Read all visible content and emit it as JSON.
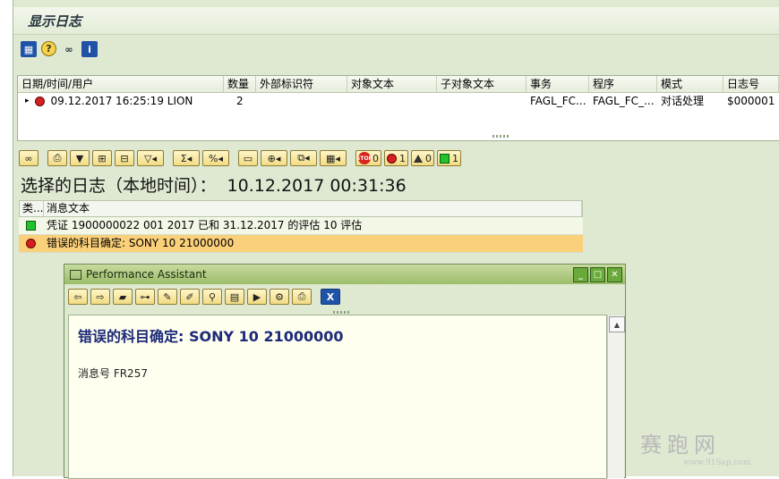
{
  "window": {
    "title": "显示日志"
  },
  "toolbar_top": {
    "buttons": [
      {
        "icon": "grid-icon"
      },
      {
        "icon": "help-icon",
        "glyph": "?"
      },
      {
        "icon": "glasses-icon",
        "glyph": "👓"
      },
      {
        "icon": "info-icon",
        "glyph": "i"
      }
    ]
  },
  "log_table": {
    "columns": [
      "日期/时间/用户",
      "数量",
      "外部标识符",
      "对象文本",
      "子对象文本",
      "事务",
      "程序",
      "模式",
      "日志号"
    ],
    "rows": [
      {
        "expander": "▸",
        "datetime_user": "09.12.2017  16:25:19  LION",
        "count": "2",
        "external_id": "",
        "object_text": "",
        "subobject_text": "",
        "transaction": "FAGL_FC...",
        "program": "FAGL_FC_...",
        "mode": "对话处理",
        "log_no": "$000001"
      }
    ]
  },
  "toolbar2": {
    "stop_count": "0",
    "error_count": "1",
    "warning_count": "0",
    "success_count": "1"
  },
  "selected_log": {
    "label": "选择的日志（本地时间）：",
    "timestamp": "10.12.2017 00:31:36"
  },
  "message_table": {
    "columns": [
      "类...",
      "消息文本"
    ],
    "rows": [
      {
        "status": "success",
        "text": "凭证 1900000022 001 2017 已和 31.12.2017 的评估 10 评估"
      },
      {
        "status": "error",
        "text": "错误的科目确定: SONY 10 21000000"
      }
    ]
  },
  "performance_assistant": {
    "title": "Performance Assistant",
    "heading": "错误的科目确定: SONY 10 21000000",
    "message_no": "消息号  FR257",
    "close_label": "X"
  },
  "watermark": {
    "brand": "赛跑网",
    "url": "www.91Sap.com"
  },
  "colors": {
    "error_row": "#fbd07a",
    "success_row": "#f2f7e6",
    "heading_blue": "#1c2a78"
  }
}
